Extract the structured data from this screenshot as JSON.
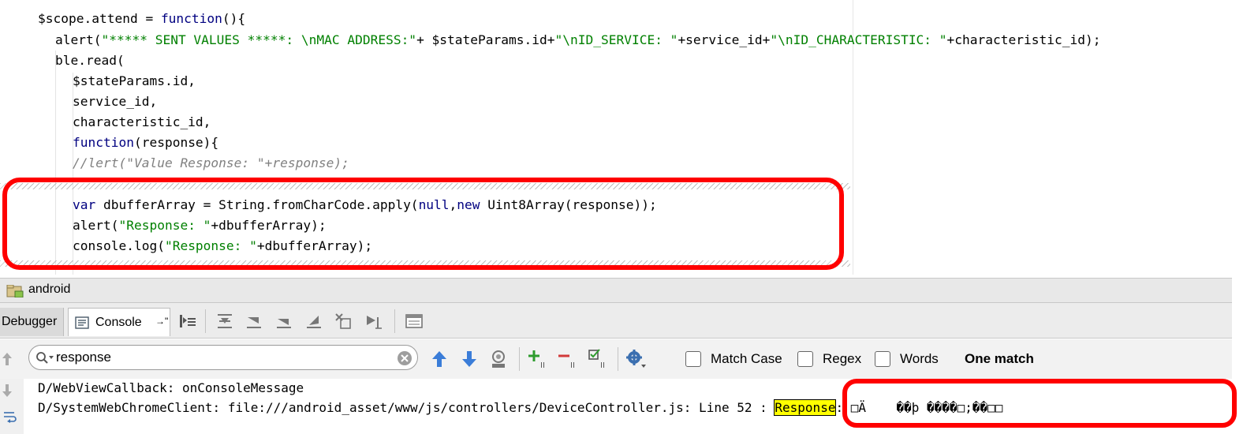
{
  "editor": {
    "lines": [
      {
        "id": "l1",
        "segments": [
          {
            "t": "$scope.attend = ",
            "c": ""
          },
          {
            "t": "function",
            "c": "kw"
          },
          {
            "t": "(){",
            "c": ""
          }
        ]
      },
      {
        "id": "l2",
        "segments": [
          {
            "t": "alert(",
            "c": ""
          },
          {
            "t": "\"***** SENT VALUES *****: \\nMAC ADDRESS:\"",
            "c": "str"
          },
          {
            "t": "+ $stateParams.id+",
            "c": ""
          },
          {
            "t": "\"\\nID_SERVICE: \"",
            "c": "str"
          },
          {
            "t": "+service_id+",
            "c": ""
          },
          {
            "t": "\"\\nID_CHARACTERISTIC: \"",
            "c": "str"
          },
          {
            "t": "+characteristic_id);",
            "c": ""
          }
        ]
      },
      {
        "id": "l3",
        "segments": [
          {
            "t": "ble.read(",
            "c": ""
          }
        ]
      },
      {
        "id": "l4",
        "segments": [
          {
            "t": "$stateParams.id,",
            "c": ""
          }
        ]
      },
      {
        "id": "l5",
        "segments": [
          {
            "t": "service_id,",
            "c": ""
          }
        ]
      },
      {
        "id": "l6",
        "segments": [
          {
            "t": "characteristic_id,",
            "c": ""
          }
        ]
      },
      {
        "id": "l7",
        "segments": [
          {
            "t": "function",
            "c": "kw"
          },
          {
            "t": "(response){",
            "c": ""
          }
        ]
      },
      {
        "id": "l8",
        "segments": [
          {
            "t": "//lert(\"Value Response: \"+response);",
            "c": "cmt"
          }
        ]
      },
      {
        "id": "l9",
        "segments": [
          {
            "t": "var ",
            "c": "kw"
          },
          {
            "t": "dbufferArray = String.fromCharCode.apply(",
            "c": ""
          },
          {
            "t": "null",
            "c": "kw"
          },
          {
            "t": ",",
            "c": ""
          },
          {
            "t": "new ",
            "c": "kw"
          },
          {
            "t": "Uint8Array(response));",
            "c": ""
          }
        ]
      },
      {
        "id": "l10",
        "segments": [
          {
            "t": "alert(",
            "c": ""
          },
          {
            "t": "\"Response: \"",
            "c": "str"
          },
          {
            "t": "+dbufferArray);",
            "c": ""
          }
        ]
      },
      {
        "id": "l11",
        "segments": [
          {
            "t": "console.log(",
            "c": ""
          },
          {
            "t": "\"Response: \"",
            "c": "str"
          },
          {
            "t": "+dbufferArray);",
            "c": ""
          }
        ]
      }
    ]
  },
  "tool_window": {
    "title": "android",
    "tabs": [
      {
        "label": "Debugger"
      },
      {
        "label": "Console"
      }
    ],
    "pin_glyph": "→\"",
    "toolbar_icons": [
      "step-list-icon",
      "show-execution-point-icon",
      "step-over-icon",
      "step-into-icon",
      "force-step-into-icon",
      "step-out-icon",
      "drop-frame-icon",
      "run-to-cursor-icon",
      "evaluate-icon"
    ]
  },
  "search": {
    "value": "response",
    "options": {
      "match_case": "Match Case",
      "regex": "Regex",
      "words": "Words"
    },
    "result": "One match"
  },
  "console": {
    "line1": "D/WebViewCallback: onConsoleMessage",
    "line2_prefix": "D/SystemWebChromeClient: file:///android_asset/www/js/controllers/DeviceController.js: Line 52 : ",
    "line2_match": "Response",
    "line2_suffix": ": □Ä    ��þ ����□;��□□"
  },
  "colors": {
    "highlight_box": "#ff0000",
    "keyword": "#000080",
    "string": "#008000",
    "match_bg": "#ffff00"
  }
}
